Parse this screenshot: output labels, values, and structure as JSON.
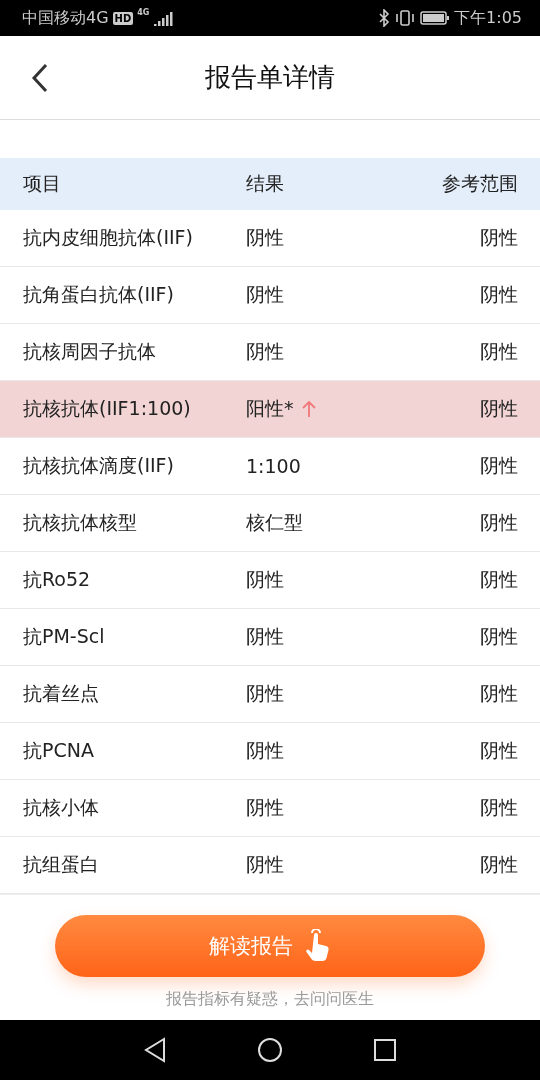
{
  "status_bar": {
    "carrier": "中国移动4G",
    "hd_badge": "HD",
    "network": "4G",
    "time": "下午1:05"
  },
  "header": {
    "title": "报告单详情"
  },
  "table": {
    "columns": [
      "项目",
      "结果",
      "参考范围"
    ],
    "rows": [
      {
        "item": "抗内皮细胞抗体(IIF)",
        "result": "阴性",
        "range": "阴性",
        "abnormal": false
      },
      {
        "item": "抗角蛋白抗体(IIF)",
        "result": "阴性",
        "range": "阴性",
        "abnormal": false
      },
      {
        "item": "抗核周因子抗体",
        "result": "阴性",
        "range": "阴性",
        "abnormal": false
      },
      {
        "item": "抗核抗体(IIF1:100)",
        "result": "阳性*",
        "range": "阴性",
        "abnormal": true
      },
      {
        "item": "抗核抗体滴度(IIF)",
        "result": "1:100",
        "range": "阴性",
        "abnormal": false
      },
      {
        "item": "抗核抗体核型",
        "result": "核仁型",
        "range": "阴性",
        "abnormal": false
      },
      {
        "item": "抗Ro52",
        "result": "阴性",
        "range": "阴性",
        "abnormal": false
      },
      {
        "item": "抗PM-Scl",
        "result": "阴性",
        "range": "阴性",
        "abnormal": false
      },
      {
        "item": "抗着丝点",
        "result": "阴性",
        "range": "阴性",
        "abnormal": false
      },
      {
        "item": "抗PCNA",
        "result": "阴性",
        "range": "阴性",
        "abnormal": false
      },
      {
        "item": "抗核小体",
        "result": "阴性",
        "range": "阴性",
        "abnormal": false
      },
      {
        "item": "抗组蛋白",
        "result": "阴性",
        "range": "阴性",
        "abnormal": false
      }
    ]
  },
  "action_button": {
    "label": "解读报告"
  },
  "hint": "报告指标有疑惑，去问问医生"
}
